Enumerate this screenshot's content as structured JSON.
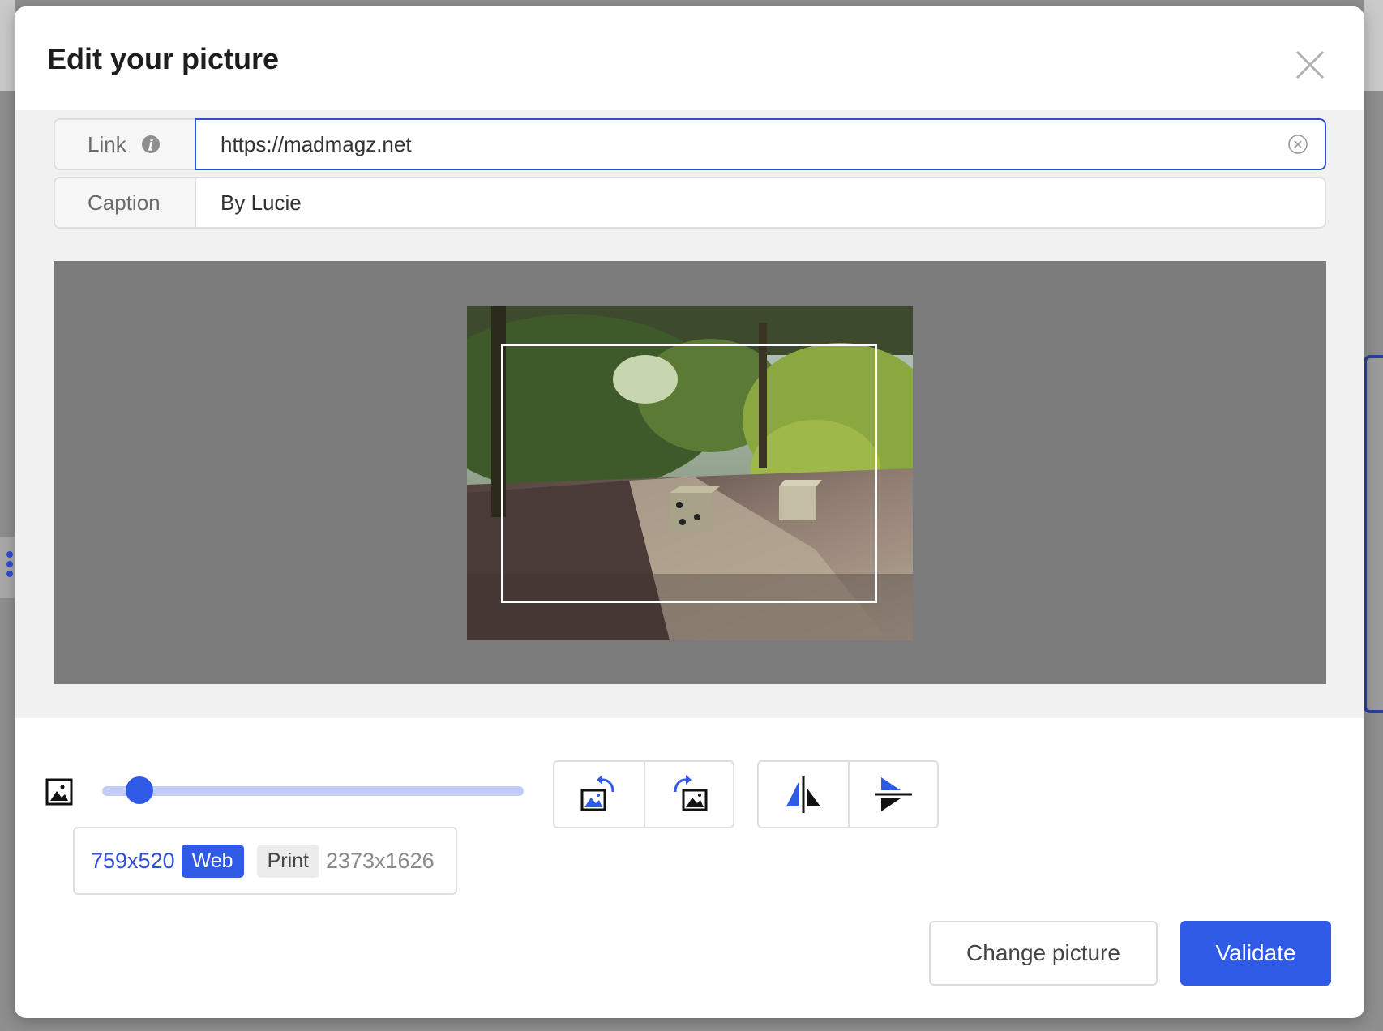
{
  "modal": {
    "title": "Edit your picture",
    "close_icon": "close-icon"
  },
  "form": {
    "link": {
      "label": "Link",
      "value": "https://madmagz.net",
      "info_icon": "info-icon",
      "clear_icon": "clear-circle-icon"
    },
    "caption": {
      "label": "Caption",
      "value": "By Lucie"
    }
  },
  "editor": {
    "zoom": {
      "min_icon": "image-small-icon",
      "max_icon": "image-large-icon",
      "value": 0.06
    },
    "rotate_buttons": [
      {
        "name": "rotate-left-button",
        "icon": "rotate-left-icon"
      },
      {
        "name": "rotate-right-button",
        "icon": "rotate-right-icon"
      }
    ],
    "flip_buttons": [
      {
        "name": "flip-horizontal-button",
        "icon": "flip-horizontal-icon"
      },
      {
        "name": "flip-vertical-button",
        "icon": "flip-vertical-icon"
      }
    ],
    "size": {
      "web_dims": "759x520",
      "web_label": "Web",
      "print_label": "Print",
      "print_dims": "2373x1626"
    }
  },
  "footer": {
    "change_label": "Change picture",
    "validate_label": "Validate"
  },
  "colors": {
    "accent": "#2f5ae6",
    "accent_text": "#2f4fd6",
    "preview_bg": "#7b7b7b",
    "slider_track": "#c3cdf7"
  }
}
